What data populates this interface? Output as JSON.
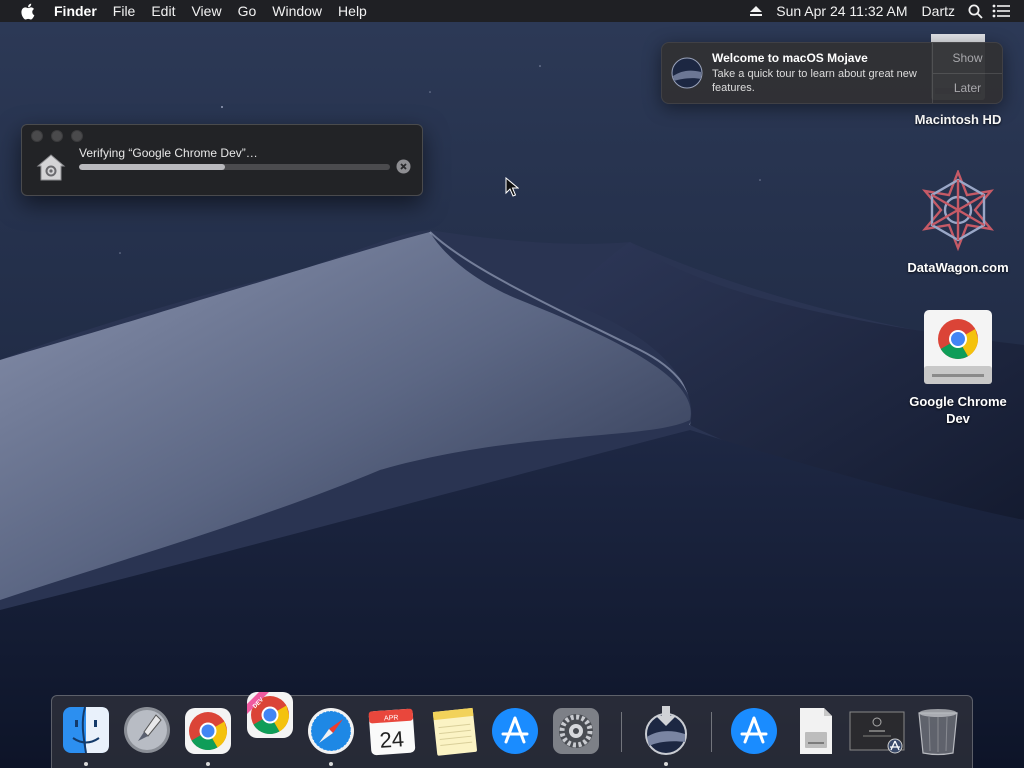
{
  "menubar": {
    "app_name": "Finder",
    "menus": [
      "File",
      "Edit",
      "View",
      "Go",
      "Window",
      "Help"
    ],
    "datetime": "Sun Apr 24  11:32 AM",
    "user": "Dartz"
  },
  "desktop": {
    "icons": [
      {
        "label": "Macintosh HD",
        "icon": "hard-drive-icon"
      },
      {
        "label": "DataWagon.com",
        "icon": "datawagon-logo-icon"
      },
      {
        "label": "Google Chrome Dev",
        "icon": "chrome-disk-image-icon"
      }
    ]
  },
  "notification": {
    "title": "Welcome to macOS Mojave",
    "text": "Take a quick tour to learn about great new features.",
    "show_label": "Show",
    "later_label": "Later",
    "icon": "mojave-dune-icon"
  },
  "verify_window": {
    "status_text": "Verifying “Google Chrome Dev”…",
    "progress": 0.47,
    "cancel_icon": "cancel-icon"
  },
  "dock": {
    "calendar_month": "APR",
    "calendar_day": "24",
    "chrome_dev_badge": "DEV",
    "apps": [
      "Finder",
      "Launchpad",
      "Google Chrome",
      "Google Chrome Dev",
      "Safari",
      "Calendar",
      "Notes",
      "App Store",
      "System Preferences",
      "macOS Mojave Installer",
      "App Store Download",
      "Preview Document",
      "Screenshot",
      "Trash"
    ]
  },
  "colors": {
    "menubar_bg": "#1e1e20",
    "progress_fill": "#b9b9bd",
    "chrome_red": "#db4437",
    "chrome_yellow": "#f4c20d",
    "chrome_green": "#0f9d58",
    "chrome_blue": "#4285f4",
    "appstore_blue": "#1a8cff"
  }
}
